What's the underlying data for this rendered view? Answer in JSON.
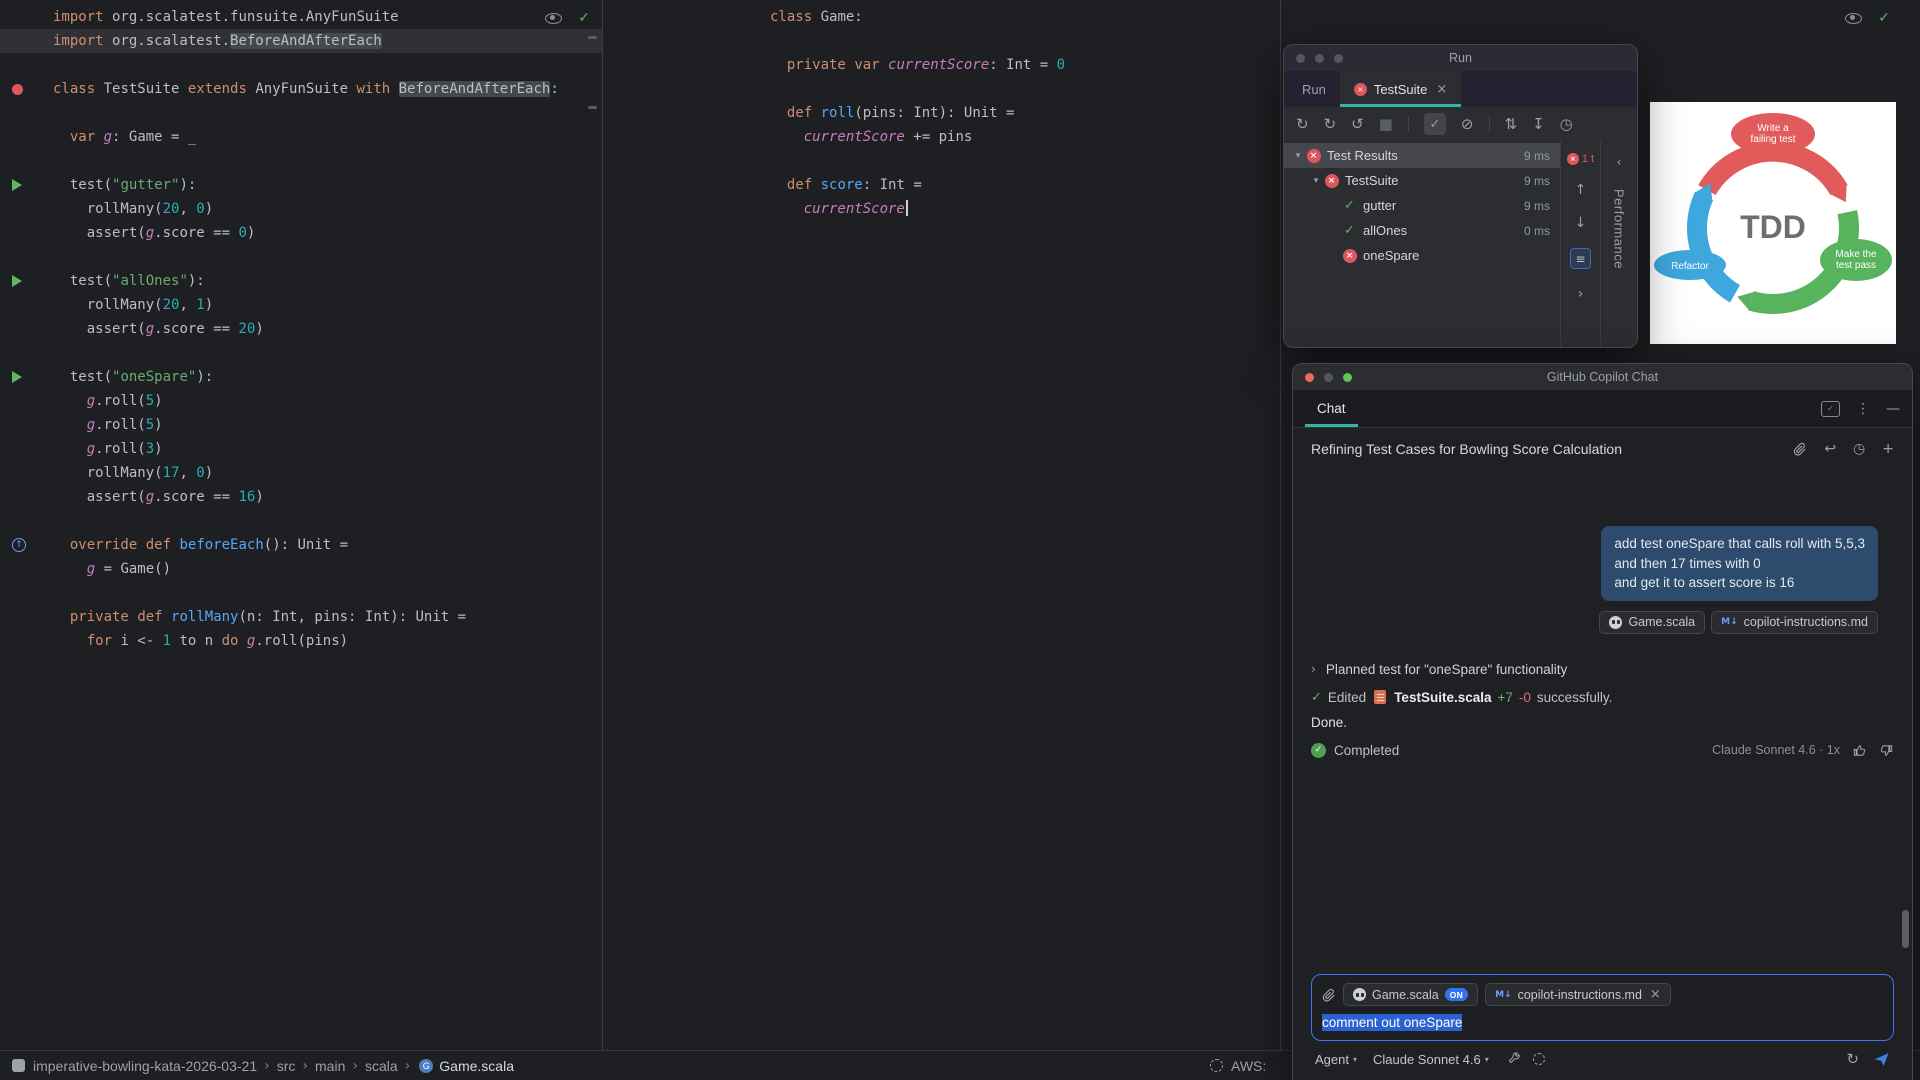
{
  "icons": {
    "check": "✓",
    "close": "×",
    "kebab": "⋮",
    "minimize": "—",
    "plus": "+",
    "undo": "↩",
    "clock": "◷",
    "up": "↑",
    "down": "↓",
    "filter": "≡",
    "chev_r": "›",
    "chev_l": "‹",
    "chev_d": "▾",
    "refresh": "↻",
    "err": "×"
  },
  "editor_left": {
    "lines": [
      {
        "t": [
          [
            "kw",
            "import"
          ],
          [
            "pl",
            " org.scalatest.funsuite.AnyFunSuite"
          ]
        ]
      },
      {
        "hl": true,
        "t": [
          [
            "kw",
            "import"
          ],
          [
            "pl",
            " org.scalatest."
          ],
          [
            "ref",
            "BeforeAndAfterEach"
          ]
        ]
      },
      {
        "t": []
      },
      {
        "g": "runerr",
        "t": [
          [
            "kw",
            "class"
          ],
          [
            "pl",
            " TestSuite "
          ],
          [
            "kw",
            "extends"
          ],
          [
            "pl",
            " AnyFunSuite "
          ],
          [
            "kw",
            "with"
          ],
          [
            "pl",
            " "
          ],
          [
            "ref",
            "BeforeAndAfterEach"
          ],
          [
            "pl",
            ":"
          ]
        ]
      },
      {
        "t": []
      },
      {
        "t": [
          [
            "pl",
            "  "
          ],
          [
            "kw",
            "var"
          ],
          [
            "pl",
            " "
          ],
          [
            "fld",
            "g"
          ],
          [
            "pl",
            ": Game = _"
          ]
        ]
      },
      {
        "t": []
      },
      {
        "g": "play",
        "t": [
          [
            "pl",
            "  test("
          ],
          [
            "str",
            "\"gutter\""
          ],
          [
            "pl",
            "):"
          ]
        ]
      },
      {
        "t": [
          [
            "pl",
            "    rollMany("
          ],
          [
            "num",
            "20"
          ],
          [
            "pl",
            ", "
          ],
          [
            "num",
            "0"
          ],
          [
            "pl",
            ")"
          ]
        ]
      },
      {
        "t": [
          [
            "pl",
            "    assert("
          ],
          [
            "fld",
            "g"
          ],
          [
            "pl",
            ".score == "
          ],
          [
            "num",
            "0"
          ],
          [
            "pl",
            ")"
          ]
        ]
      },
      {
        "t": []
      },
      {
        "g": "play",
        "t": [
          [
            "pl",
            "  test("
          ],
          [
            "str",
            "\"allOnes\""
          ],
          [
            "pl",
            "):"
          ]
        ]
      },
      {
        "t": [
          [
            "pl",
            "    rollMany("
          ],
          [
            "num",
            "20"
          ],
          [
            "pl",
            ", "
          ],
          [
            "num",
            "1"
          ],
          [
            "pl",
            ")"
          ]
        ]
      },
      {
        "t": [
          [
            "pl",
            "    assert("
          ],
          [
            "fld",
            "g"
          ],
          [
            "pl",
            ".score == "
          ],
          [
            "num",
            "20"
          ],
          [
            "pl",
            ")"
          ]
        ]
      },
      {
        "t": []
      },
      {
        "g": "play",
        "t": [
          [
            "pl",
            "  test("
          ],
          [
            "str",
            "\"oneSpare\""
          ],
          [
            "pl",
            "):"
          ]
        ]
      },
      {
        "t": [
          [
            "pl",
            "    "
          ],
          [
            "fld",
            "g"
          ],
          [
            "pl",
            ".roll("
          ],
          [
            "num",
            "5"
          ],
          [
            "pl",
            ")"
          ]
        ]
      },
      {
        "t": [
          [
            "pl",
            "    "
          ],
          [
            "fld",
            "g"
          ],
          [
            "pl",
            ".roll("
          ],
          [
            "num",
            "5"
          ],
          [
            "pl",
            ")"
          ]
        ]
      },
      {
        "t": [
          [
            "pl",
            "    "
          ],
          [
            "fld",
            "g"
          ],
          [
            "pl",
            ".roll("
          ],
          [
            "num",
            "3"
          ],
          [
            "pl",
            ")"
          ]
        ]
      },
      {
        "t": [
          [
            "pl",
            "    rollMany("
          ],
          [
            "num",
            "17"
          ],
          [
            "pl",
            ", "
          ],
          [
            "num",
            "0"
          ],
          [
            "pl",
            ")"
          ]
        ]
      },
      {
        "t": [
          [
            "pl",
            "    assert("
          ],
          [
            "fld",
            "g"
          ],
          [
            "pl",
            ".score == "
          ],
          [
            "num",
            "16"
          ],
          [
            "pl",
            ")"
          ]
        ]
      },
      {
        "t": []
      },
      {
        "g": "ovr",
        "t": [
          [
            "pl",
            "  "
          ],
          [
            "kw",
            "override"
          ],
          [
            "pl",
            " "
          ],
          [
            "kw",
            "def"
          ],
          [
            "pl",
            " "
          ],
          [
            "fn",
            "beforeEach"
          ],
          [
            "pl",
            "(): Unit ="
          ]
        ]
      },
      {
        "t": [
          [
            "pl",
            "    "
          ],
          [
            "fld",
            "g"
          ],
          [
            "pl",
            " = Game()"
          ]
        ]
      },
      {
        "t": []
      },
      {
        "t": [
          [
            "pl",
            "  "
          ],
          [
            "kw",
            "private"
          ],
          [
            "pl",
            " "
          ],
          [
            "kw",
            "def"
          ],
          [
            "pl",
            " "
          ],
          [
            "fn",
            "rollMany"
          ],
          [
            "pl",
            "(n: Int, pins: Int): Unit ="
          ]
        ]
      },
      {
        "t": [
          [
            "pl",
            "    "
          ],
          [
            "kw",
            "for"
          ],
          [
            "pl",
            " i <- "
          ],
          [
            "num",
            "1"
          ],
          [
            "pl",
            " to n "
          ],
          [
            "kw",
            "do"
          ],
          [
            "pl",
            " "
          ],
          [
            "fld",
            "g"
          ],
          [
            "pl",
            ".roll(pins)"
          ]
        ]
      }
    ]
  },
  "editor_middle": {
    "lines": [
      {
        "t": [
          [
            "kw",
            "class"
          ],
          [
            "pl",
            " Game:"
          ]
        ]
      },
      {
        "t": []
      },
      {
        "t": [
          [
            "pl",
            "  "
          ],
          [
            "kw",
            "private"
          ],
          [
            "pl",
            " "
          ],
          [
            "kw",
            "var"
          ],
          [
            "pl",
            " "
          ],
          [
            "fld",
            "currentScore"
          ],
          [
            "pl",
            ": Int = "
          ],
          [
            "num",
            "0"
          ]
        ]
      },
      {
        "t": []
      },
      {
        "t": [
          [
            "pl",
            "  "
          ],
          [
            "kw",
            "def"
          ],
          [
            "pl",
            " "
          ],
          [
            "fn",
            "roll"
          ],
          [
            "pl",
            "(pins: Int): Unit ="
          ]
        ]
      },
      {
        "t": [
          [
            "pl",
            "    "
          ],
          [
            "fld",
            "currentScore"
          ],
          [
            "pl",
            " += pins"
          ]
        ]
      },
      {
        "t": []
      },
      {
        "t": [
          [
            "pl",
            "  "
          ],
          [
            "kw",
            "def"
          ],
          [
            "pl",
            " "
          ],
          [
            "fn",
            "score"
          ],
          [
            "pl",
            ": Int ="
          ]
        ]
      },
      {
        "cur": true,
        "t": [
          [
            "pl",
            "    "
          ],
          [
            "fld",
            "currentScore"
          ]
        ]
      }
    ]
  },
  "run_window": {
    "title": "Run",
    "tabs": [
      {
        "label": "Run"
      },
      {
        "label": "TestSuite"
      }
    ],
    "toolbar": [
      {
        "name": "rerun-tests-icon",
        "glyph": "↻"
      },
      {
        "name": "rerun-failed-tests-icon",
        "glyph": "↻"
      },
      {
        "name": "toggle-auto-test-icon",
        "glyph": "↺"
      },
      {
        "name": "stop-icon",
        "glyph": "■",
        "disabled": true
      },
      {
        "sep": true
      },
      {
        "name": "show-passed-icon",
        "glyph": "✓",
        "boxed": true
      },
      {
        "name": "show-ignored-icon",
        "glyph": "⊘"
      },
      {
        "sep": true
      },
      {
        "name": "sort-by-duration-icon",
        "glyph": "⇅"
      },
      {
        "name": "import-test-results-icon",
        "glyph": "↧"
      },
      {
        "name": "test-history-icon",
        "glyph": "◷"
      }
    ],
    "tree": [
      {
        "depth": 0,
        "chevron": true,
        "icon": "error",
        "label": "Test Results",
        "time": "9 ms",
        "selected": true
      },
      {
        "depth": 1,
        "chevron": true,
        "icon": "error",
        "label": "TestSuite",
        "time": "9 ms"
      },
      {
        "depth": 2,
        "chevron": false,
        "icon": "pass",
        "label": "gutter",
        "time": "9 ms"
      },
      {
        "depth": 2,
        "chevron": false,
        "icon": "pass",
        "label": "allOnes",
        "time": "0 ms"
      },
      {
        "depth": 2,
        "chevron": false,
        "icon": "error",
        "label": "oneSpare",
        "time": ""
      }
    ],
    "failed_badge": "1 t",
    "side_tab_label": "Performance"
  },
  "tdd": {
    "center": "TDD",
    "steps": [
      {
        "name": "write-failing-test",
        "lines": [
          "Write a",
          "failing test"
        ],
        "color": "#e15b5b"
      },
      {
        "name": "make-test-pass",
        "lines": [
          "Make the",
          "test pass"
        ],
        "color": "#57b35c"
      },
      {
        "name": "refactor",
        "lines": [
          "Refactor"
        ],
        "color": "#3ea7dd"
      }
    ]
  },
  "copilot": {
    "window_title": "GitHub Copilot Chat",
    "tab_label": "Chat",
    "thread_title": "Refining Test Cases for Bowling Score Calculation",
    "user_message": "add test oneSpare that calls roll with 5,5,3\nand then 17 times with 0\nand get it to assert score is 16",
    "message_chips": [
      {
        "label": "Game.scala",
        "icon": "copilot"
      },
      {
        "label": "copilot-instructions.md",
        "icon": "markdown"
      }
    ],
    "plan_step": "Planned test for \"oneSpare\" functionality",
    "edited": {
      "prefix": "Edited",
      "file": "TestSuite.scala",
      "added": "+7",
      "removed": "-0",
      "suffix": "successfully."
    },
    "done": "Done.",
    "completed": "Completed",
    "model_note": "Claude Sonnet 4.6 · 1x",
    "input": {
      "chips": [
        {
          "label": "Game.scala",
          "icon": "copilot",
          "badge": "ON"
        },
        {
          "label": "copilot-instructions.md",
          "icon": "markdown",
          "close": "×"
        }
      ],
      "text": "comment out oneSpare",
      "mode_label": "Agent",
      "model_label": "Claude Sonnet 4.6"
    }
  },
  "status_bar": {
    "project": "imperative-bowling-kata-2026-03-21",
    "crumbs": [
      "src",
      "main",
      "scala"
    ],
    "file": "Game.scala",
    "right_label": "AWS:"
  }
}
